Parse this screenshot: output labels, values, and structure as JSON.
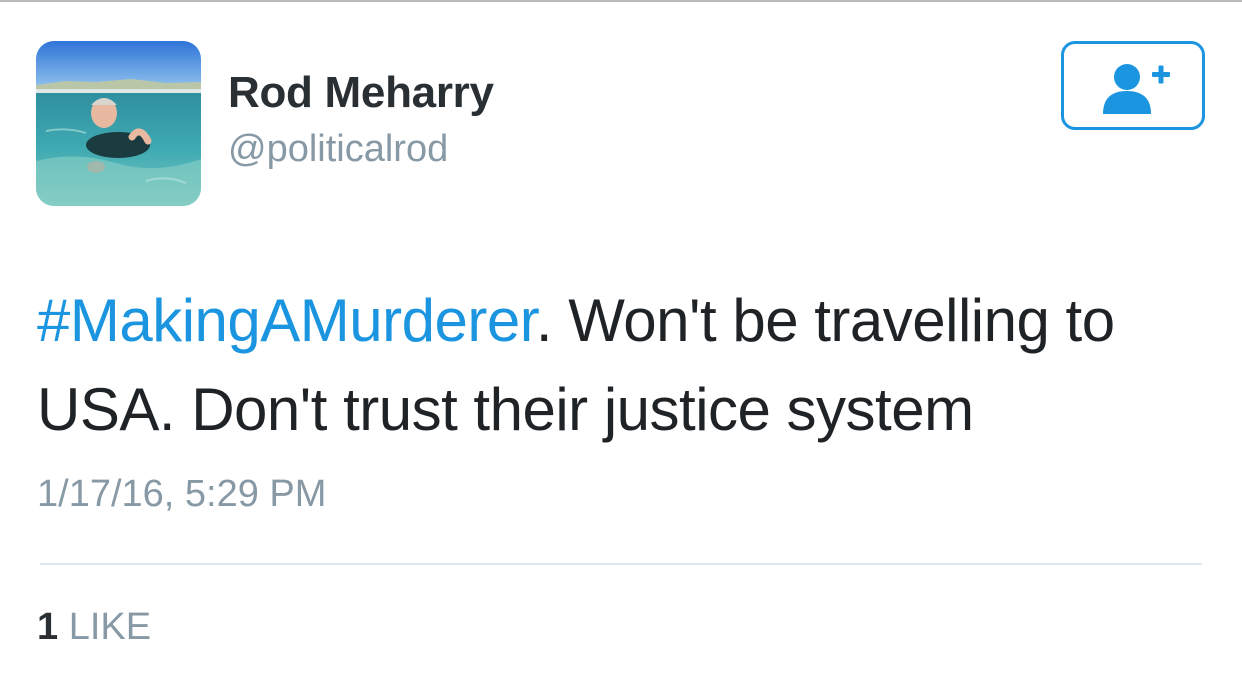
{
  "user": {
    "display_name": "Rod Meharry",
    "handle": "@politicalrod"
  },
  "follow_button": {
    "icon": "follow-user-plus-icon"
  },
  "tweet": {
    "hashtag": "#MakingAMurderer",
    "text_after_hashtag": ". Won't be travelling to USA. Don't trust their justice system",
    "timestamp": "1/17/16, 5:29 PM"
  },
  "stats": {
    "likes_count": "1",
    "likes_label": "LIKE"
  },
  "colors": {
    "accent": "#1b95e0",
    "secondary_text": "#8899a6",
    "primary_text": "#292f33"
  }
}
